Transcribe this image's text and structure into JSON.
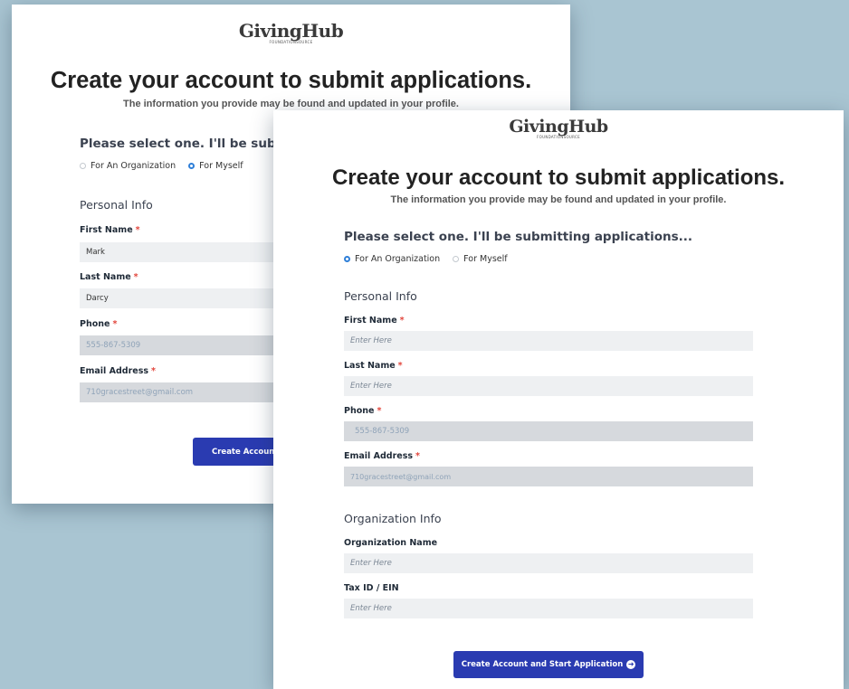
{
  "brand": {
    "logo_text": "GivingHub",
    "logo_sub": "FOUNDATIONSOURCE"
  },
  "back_card": {
    "headline": "Create your account to submit applications.",
    "subline": "The information you provide may be found and updated in your profile.",
    "question": "Please select one. I'll be submitting applications...",
    "options": [
      {
        "label": "For An Organization",
        "checked": false
      },
      {
        "label": "For Myself",
        "checked": true
      }
    ],
    "personal_title": "Personal Info",
    "fields": [
      {
        "label": "First Name",
        "required": "*",
        "value": "Mark"
      },
      {
        "label": "Last Name",
        "required": "*",
        "value": "Darcy"
      },
      {
        "label": "Phone",
        "required": "*",
        "value": "555-867-5309"
      },
      {
        "label": "Email Address",
        "required": "*",
        "value": "710gracestreet@gmail.com"
      }
    ],
    "button_label": "Create Account and Start Application"
  },
  "front_card": {
    "headline": "Create your account to submit applications.",
    "subline": "The information you provide may be found and updated in your profile.",
    "question": "Please select one. I'll be submitting applications...",
    "options": [
      {
        "label": "For An Organization",
        "checked": true
      },
      {
        "label": "For Myself",
        "checked": false
      }
    ],
    "personal_title": "Personal Info",
    "personal_fields": [
      {
        "label": "First Name",
        "required": "*",
        "placeholder": "Enter Here"
      },
      {
        "label": "Last Name",
        "required": "*",
        "placeholder": "Enter Here"
      },
      {
        "label": "Phone",
        "required": "*",
        "value": "555-867-5309"
      },
      {
        "label": "Email Address",
        "required": "*",
        "value": "710gracestreet@gmail.com"
      }
    ],
    "org_title": "Organization Info",
    "org_fields": [
      {
        "label": "Organization Name",
        "placeholder": "Enter Here"
      },
      {
        "label": "Tax ID / EIN",
        "placeholder": "Enter Here"
      }
    ],
    "button_label": "Create Account and Start Application"
  },
  "icons": {
    "button_arrow": "arrow-right-circle-icon",
    "radio": "radio-icon"
  },
  "colors": {
    "accent": "#2a3bb1",
    "radio_checked": "#2f7fd8",
    "required": "#e2453b",
    "backdrop": "#a9c5d2"
  }
}
